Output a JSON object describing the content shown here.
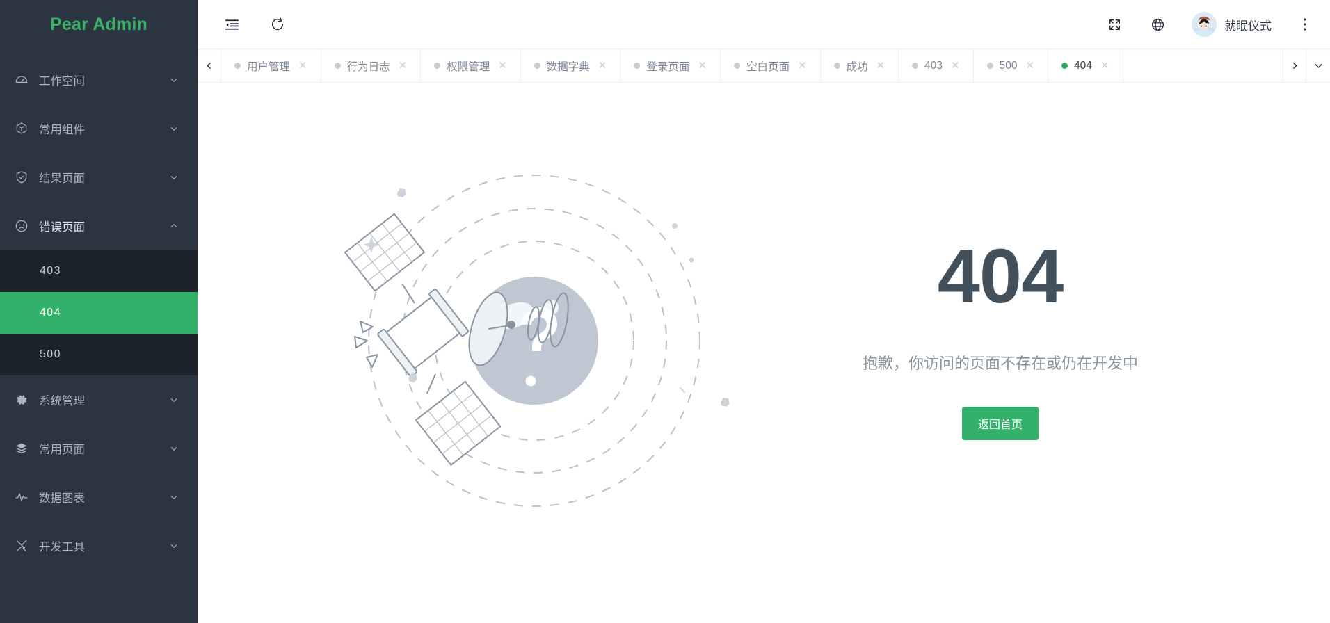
{
  "sidebar": {
    "logo": "Pear Admin",
    "items": [
      {
        "label": "工作空间",
        "icon": "dashboard-icon",
        "expanded": false
      },
      {
        "label": "常用组件",
        "icon": "cube-icon",
        "expanded": false
      },
      {
        "label": "结果页面",
        "icon": "shield-check-icon",
        "expanded": false
      },
      {
        "label": "错误页面",
        "icon": "sad-face-icon",
        "expanded": true
      },
      {
        "label": "系统管理",
        "icon": "gear-icon",
        "expanded": false
      },
      {
        "label": "常用页面",
        "icon": "layers-icon",
        "expanded": false
      },
      {
        "label": "数据图表",
        "icon": "pulse-icon",
        "expanded": false
      },
      {
        "label": "开发工具",
        "icon": "tools-icon",
        "expanded": false
      }
    ],
    "submenu": [
      {
        "label": "403",
        "active": false
      },
      {
        "label": "404",
        "active": true
      },
      {
        "label": "500",
        "active": false
      }
    ]
  },
  "topbar": {
    "collapse_icon": "menu-fold-icon",
    "refresh_icon": "refresh-icon",
    "fullscreen_icon": "fullscreen-icon",
    "language_icon": "globe-icon",
    "username": "就眠仪式",
    "more_icon": "kebab-menu-icon"
  },
  "tabs": {
    "prev_label": "‹",
    "next_label": "›",
    "dropdown_label": "⌄",
    "items": [
      {
        "label": "用户管理",
        "active": false
      },
      {
        "label": "行为日志",
        "active": false
      },
      {
        "label": "权限管理",
        "active": false
      },
      {
        "label": "数据字典",
        "active": false
      },
      {
        "label": "登录页面",
        "active": false
      },
      {
        "label": "空白页面",
        "active": false
      },
      {
        "label": "成功",
        "active": false
      },
      {
        "label": "403",
        "active": false
      },
      {
        "label": "500",
        "active": false
      },
      {
        "label": "404",
        "active": true
      }
    ],
    "close_label": "✕"
  },
  "error_page": {
    "code": "404",
    "description": "抱歉，你访问的页面不存在或仍在开发中",
    "button_label": "返回首页",
    "illustration": "satellite-orbiting-planet-question-mark"
  },
  "colors": {
    "accent_green": "#33b06a",
    "logo_green": "#3bb168",
    "sidebar_bg": "#2b3542",
    "submenu_bg": "#1c232b",
    "error_code": "#42505c",
    "muted_text": "#8a949e"
  }
}
